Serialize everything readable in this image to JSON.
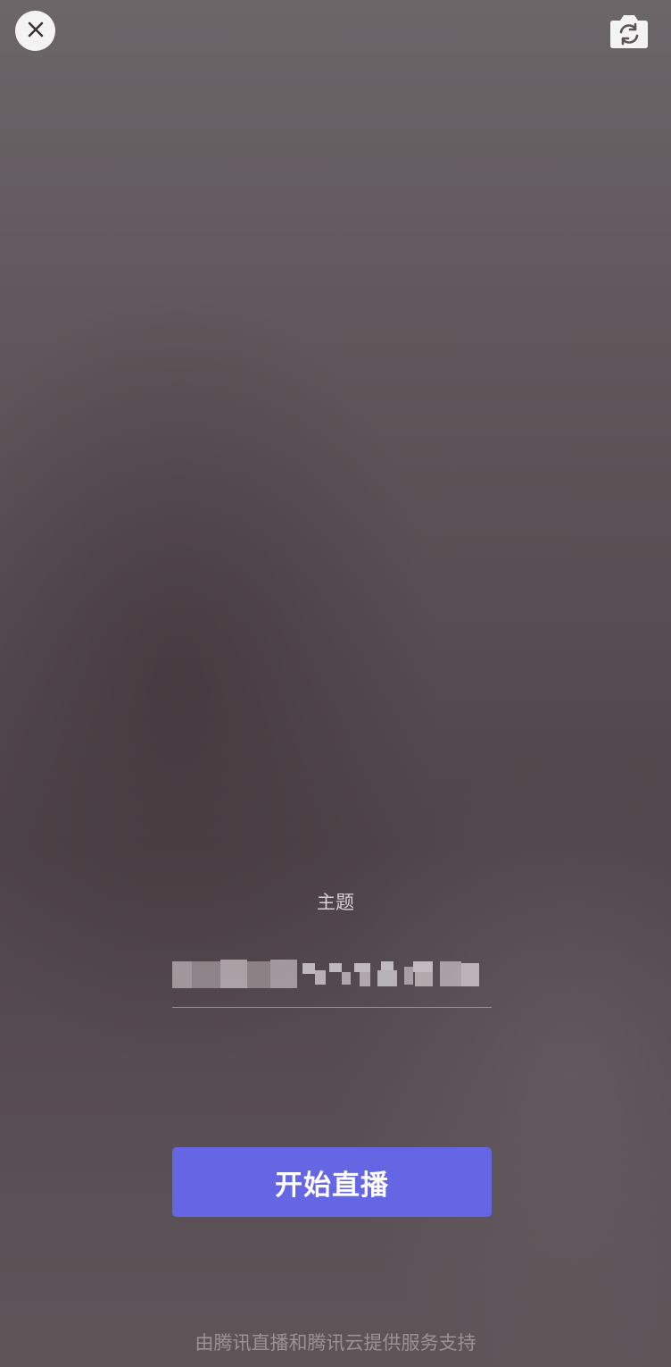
{
  "header": {
    "close_icon": "close-icon",
    "camera_icon": "switch-camera-icon"
  },
  "form": {
    "topic_label": "主题",
    "topic_value": "▇▇▇▇▇▇▇▇▇▇▇▇"
  },
  "actions": {
    "start_label": "开始直播"
  },
  "footer": {
    "text": "由腾讯直播和腾讯云提供服务支持"
  },
  "colors": {
    "accent": "#6566e4",
    "background": "#574d52"
  }
}
